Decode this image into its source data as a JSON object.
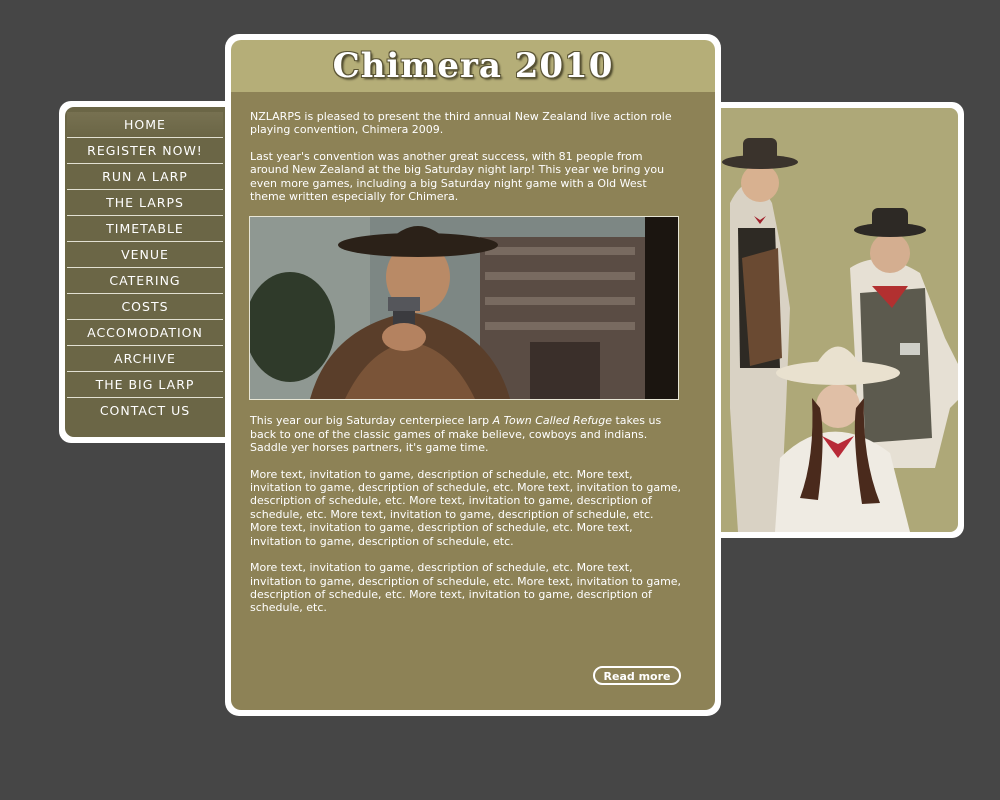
{
  "title": "Chimera 2010",
  "nav": {
    "items": [
      {
        "label": "HOME"
      },
      {
        "label": "REGISTER NOW!"
      },
      {
        "label": "RUN A LARP"
      },
      {
        "label": "THE LARPS"
      },
      {
        "label": "TIMETABLE"
      },
      {
        "label": "VENUE"
      },
      {
        "label": "CATERING"
      },
      {
        "label": "COSTS"
      },
      {
        "label": "ACCOMODATION"
      },
      {
        "label": "ARCHIVE"
      },
      {
        "label": "THE BIG LARP"
      },
      {
        "label": "CONTACT US"
      }
    ]
  },
  "content": {
    "intro": "NZLARPS is pleased to present the third annual New Zealand live action role playing convention, Chimera 2009.",
    "last_year": "Last year's convention was another great success, with 81 people from around New Zealand at the big Saturday night larp! This year we bring you even more games, including a big Saturday night game with a Old West theme written especially for Chimera.",
    "centerpiece_pre": "This year our big Saturday centerpiece larp ",
    "centerpiece_title": "A Town Called Refuge",
    "centerpiece_post": " takes us back to one of the classic games of make believe, cowboys and indians. Saddle yer horses partners, it's game time.",
    "filler1": "More text, invitation to game, description of schedule, etc. More text, invitation to game, description of schedule, etc. More text, invitation to game, description of schedule, etc. More text, invitation to game, description of schedule, etc. More text, invitation to game, description of schedule, etc. More text, invitation to game, description of schedule, etc. More text, invitation to game, description of schedule, etc.",
    "filler2": "More text, invitation to game, description of schedule, etc. More text, invitation to game, description of schedule, etc. More text, invitation to game, description of schedule, etc. More text, invitation to game, description of schedule, etc."
  },
  "read_more": "Read more",
  "colors": {
    "page_bg": "#464646",
    "nav_bg": "#6b6646",
    "content_bg": "#8d8256",
    "header_bg": "#b5ae78",
    "photo_bg": "#aea878"
  }
}
